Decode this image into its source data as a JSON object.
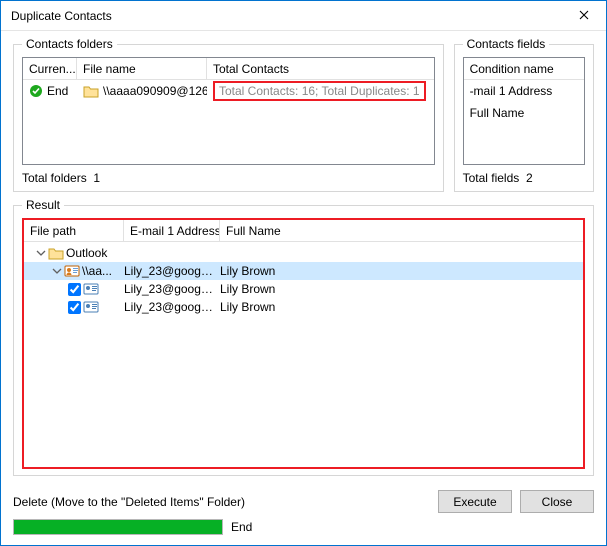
{
  "window": {
    "title": "Duplicate Contacts"
  },
  "folders": {
    "legend": "Contacts folders",
    "headers": {
      "status": "Curren...",
      "file": "File name",
      "total": "Total Contacts"
    },
    "row": {
      "status": "End",
      "file": "\\\\aaaa090909@126...",
      "summary": "Total Contacts: 16; Total Duplicates: 1"
    },
    "totals_label": "Total folders",
    "totals_value": "1"
  },
  "fields": {
    "legend": "Contacts fields",
    "header": "Condition name",
    "rows": [
      "-mail 1 Address",
      "Full Name"
    ],
    "totals_label": "Total fields",
    "totals_value": "2"
  },
  "result": {
    "legend": "Result",
    "headers": {
      "path": "File path",
      "email": "E-mail 1 Address",
      "full": "Full Name"
    },
    "root_label": "Outlook",
    "account_label": "\\\\aa...",
    "rows": [
      {
        "email": "Lily_23@google...",
        "full": "Lily Brown",
        "selected": true,
        "checked": false
      },
      {
        "email": "Lily_23@google...",
        "full": "Lily Brown",
        "selected": false,
        "checked": true
      },
      {
        "email": "Lily_23@google...",
        "full": "Lily Brown",
        "selected": false,
        "checked": true
      }
    ]
  },
  "footer": {
    "delete_label": "Delete (Move to the \"Deleted Items\" Folder)",
    "execute_label": "Execute",
    "close_label": "Close",
    "progress_status": "End",
    "progress_percent": 100
  }
}
